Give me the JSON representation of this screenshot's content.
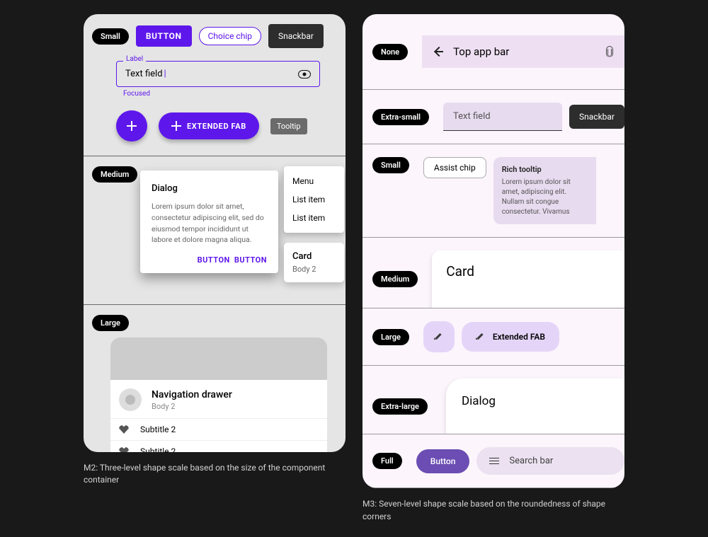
{
  "m2": {
    "caption": "M2: Three-level shape scale based on the size of the component container",
    "small": {
      "label": "Small",
      "button": "BUTTON",
      "chip": "Choice chip",
      "snackbar": "Snackbar",
      "textfield": {
        "label": "Label",
        "value": "Text field",
        "helper": "Focused"
      },
      "extendedFab": "EXTENDED FAB",
      "tooltip": "Tooltip"
    },
    "medium": {
      "label": "Medium",
      "dialog": {
        "title": "Dialog",
        "body": "Lorem ipsum dolor sit amet, consectetur adipiscing elit, sed do eiusmod tempor incididunt ut labore et dolore magna aliqua.",
        "action": "BUTTON"
      },
      "menu": [
        "Menu",
        "List item",
        "List item"
      ],
      "card": {
        "title": "Card",
        "body": "Body 2"
      }
    },
    "large": {
      "label": "Large",
      "drawer": {
        "title": "Navigation drawer",
        "subtitle": "Body 2",
        "item": "Subtitle 2"
      }
    }
  },
  "m3": {
    "caption": "M3: Seven-level shape scale based on the roundedness of shape corners",
    "none": {
      "label": "None",
      "topbar": "Top app bar"
    },
    "xs": {
      "label": "Extra-small",
      "textfield": "Text field",
      "snackbar": "Snackbar"
    },
    "small": {
      "label": "Small",
      "chip": "Assist chip",
      "tooltip": {
        "title": "Rich tooltip",
        "body": "Lorem ipsum dolor sit amet, adipiscing elit. Nullam sit congue consectetur. Vivamus"
      }
    },
    "medium": {
      "label": "Medium",
      "card": "Card"
    },
    "large": {
      "label": "Large",
      "xfab": "Extended FAB"
    },
    "xl": {
      "label": "Extra-large",
      "dialog": "Dialog"
    },
    "full": {
      "label": "Full",
      "button": "Button",
      "search": "Search bar"
    }
  }
}
